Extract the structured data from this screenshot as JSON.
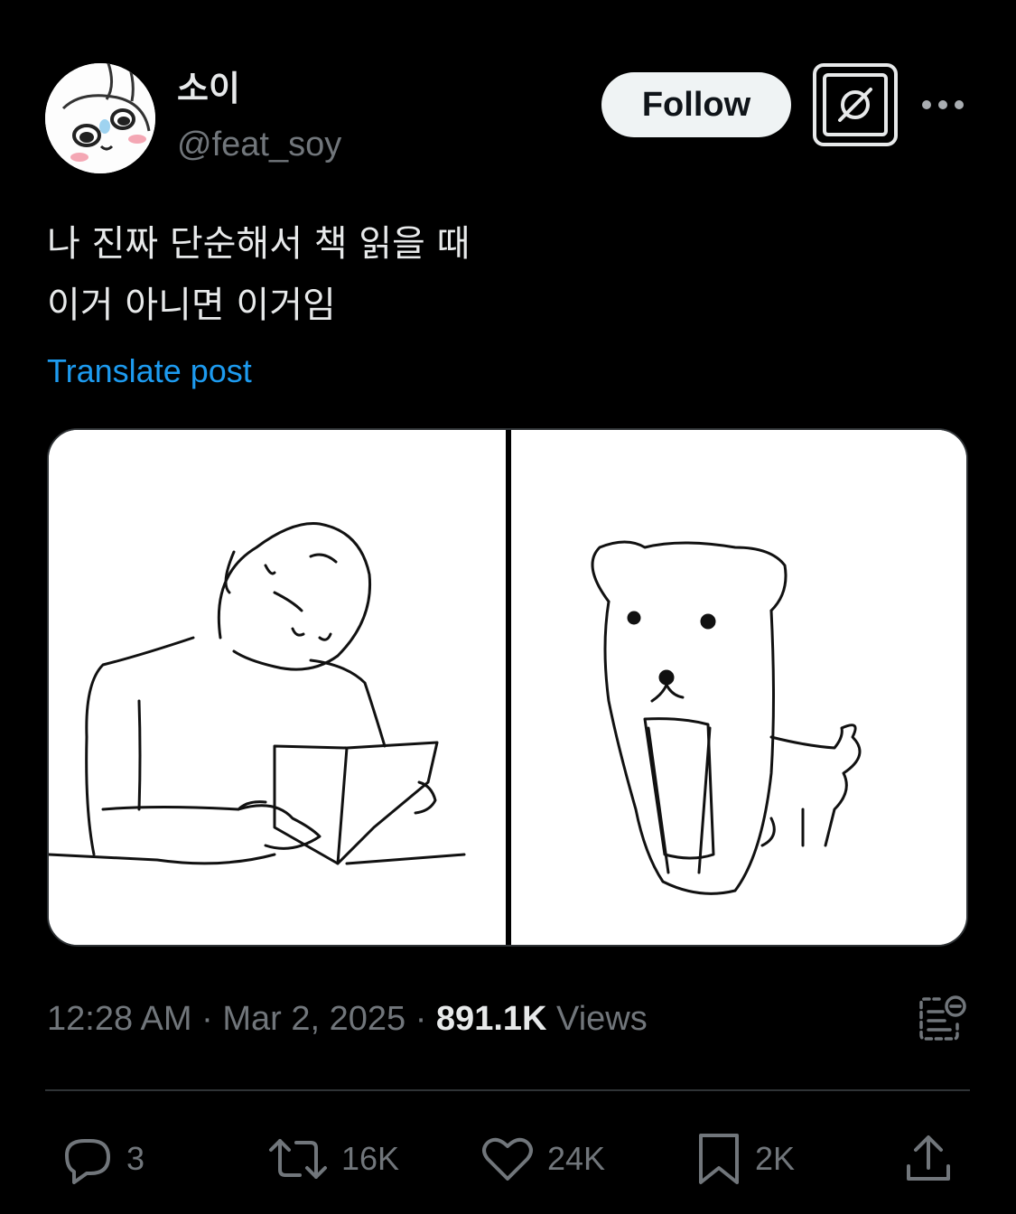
{
  "author": {
    "display_name": "소이",
    "handle": "@feat_soy",
    "avatar_icon": "bunny-avatar-icon"
  },
  "header": {
    "follow_label": "Follow",
    "grok_icon": "grok-icon",
    "more_icon": "more-icon"
  },
  "post": {
    "text": "나 진짜 단순해서 책 읽을 때\n이거 아니면 이거임",
    "translate_label": "Translate post",
    "media": [
      {
        "icon": "man-reading-book-drawing"
      },
      {
        "icon": "dog-long-mouth-drawing"
      }
    ]
  },
  "meta": {
    "time": "12:28 AM",
    "separator": " · ",
    "date": "Mar 2, 2025",
    "views_count": "891.1K",
    "views_label": "Views",
    "analytics_icon": "analytics-icon"
  },
  "actions": {
    "replies": "3",
    "reposts": "16K",
    "likes": "24K",
    "bookmarks": "2K",
    "share_icon": "share-icon"
  },
  "colors": {
    "background": "#000000",
    "text_primary": "#e7e9ea",
    "text_secondary": "#71767b",
    "link": "#1d9bf0",
    "divider": "#2f3336"
  }
}
